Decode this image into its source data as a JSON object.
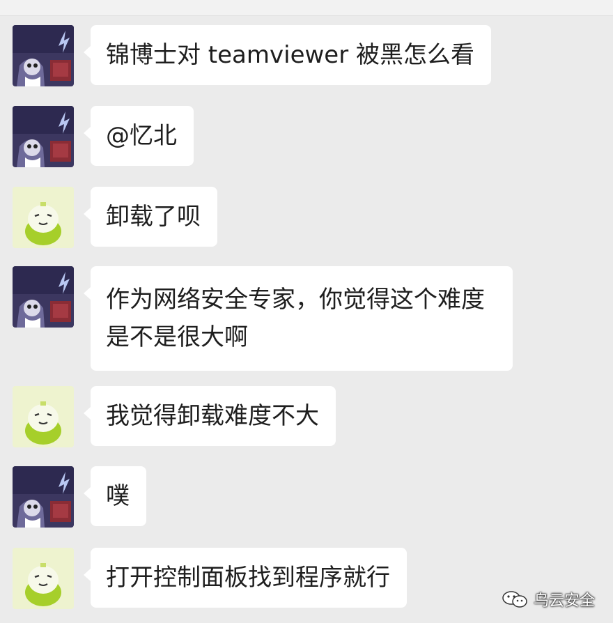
{
  "messages": [
    {
      "sender": "purple-user",
      "text": "锦博士对 teamviewer 被黑怎么看"
    },
    {
      "sender": "purple-user",
      "text": "@忆北"
    },
    {
      "sender": "green-user",
      "text": "卸载了呗"
    },
    {
      "sender": "purple-user",
      "text": "作为网络安全专家，你觉得这个难度是不是很大啊"
    },
    {
      "sender": "green-user",
      "text": "我觉得卸载难度不大"
    },
    {
      "sender": "purple-user",
      "text": "噗"
    },
    {
      "sender": "green-user",
      "text": "打开控制面板找到程序就行"
    }
  ],
  "watermark": {
    "text": "乌云安全",
    "icon": "wechat-icon"
  },
  "colors": {
    "background": "#ebebeb",
    "bubble": "#ffffff",
    "text": "#1e1e1e",
    "avatar_purple_bg": "#3c3760",
    "avatar_green_bg": "#eef3cf",
    "avatar_green_body": "#a6cf2a"
  }
}
